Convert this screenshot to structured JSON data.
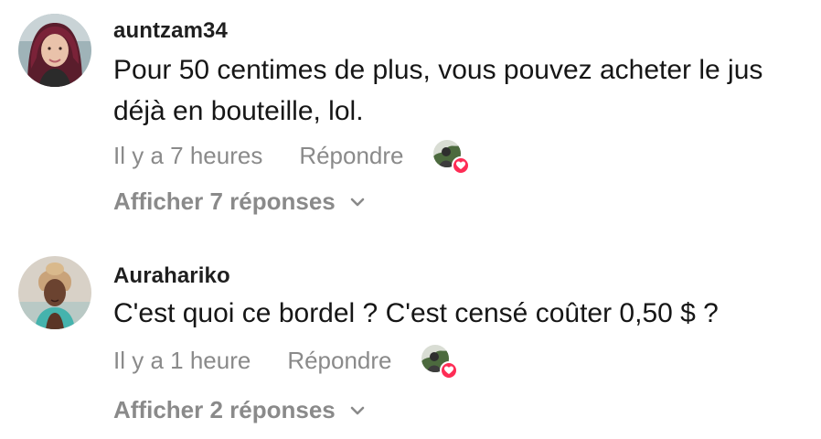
{
  "comments": [
    {
      "username": "auntzam34",
      "text": "Pour 50 centimes de plus, vous pouvez acheter le jus déjà en bouteille, lol.",
      "time": "Il y a 7 heures",
      "reply_label": "Répondre",
      "view_replies_label": "Afficher 7 réponses",
      "avatar_icon": "user-avatar",
      "liker_icon": "creator-avatar",
      "badge_icon": "heart-icon"
    },
    {
      "username": "Aurahariko",
      "text": "C'est quoi ce bordel ? C'est censé coûter 0,50 $ ?",
      "time": "Il y a 1 heure",
      "reply_label": "Répondre",
      "view_replies_label": "Afficher 2 réponses",
      "avatar_icon": "user-avatar",
      "liker_icon": "creator-avatar",
      "badge_icon": "heart-icon"
    }
  ],
  "colors": {
    "heart_badge": "#fe2c55",
    "secondary_text": "#8a8a8a",
    "primary_text": "#161616"
  }
}
